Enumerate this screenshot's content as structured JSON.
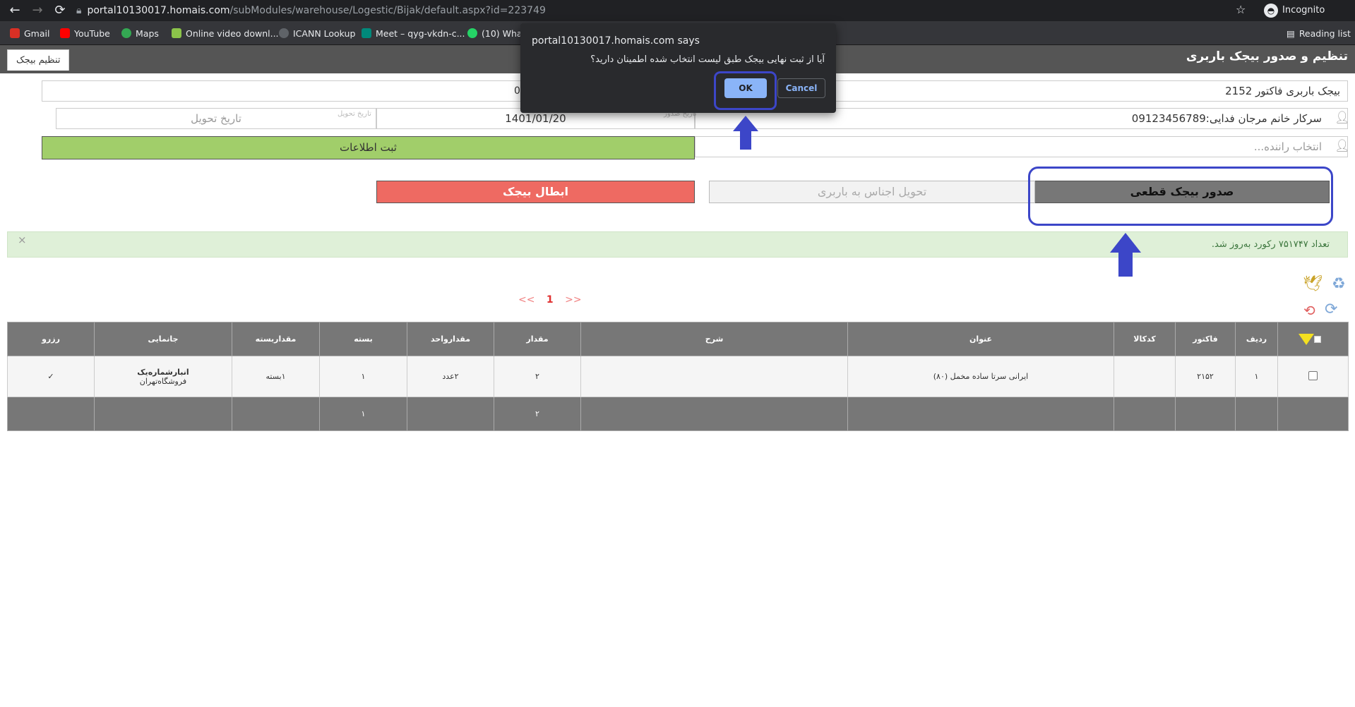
{
  "browser": {
    "url_host": "portal10130017.homais.com",
    "url_path": "/subModules/warehouse/Logestic/Bijak/default.aspx?id=223749",
    "profile_label": "Incognito",
    "reading_list_label": "Reading list",
    "bookmarks": [
      {
        "label": "Gmail",
        "color": "#d93025"
      },
      {
        "label": "YouTube",
        "color": "#ff0000"
      },
      {
        "label": "Maps",
        "color": "#34a853"
      },
      {
        "label": "Online video downl...",
        "color": "#8bc34a"
      },
      {
        "label": "ICANN Lookup",
        "color": "#5f6368"
      },
      {
        "label": "Meet – qyg-vkdn-c...",
        "color": "#00897b"
      },
      {
        "label": "(10) What",
        "color": "#25d366"
      }
    ]
  },
  "page": {
    "title": "تنظیم و صدور بیجک باربری",
    "tab_label": "تنظیم بیجک"
  },
  "form": {
    "bijak_title": "بیجک باربری فاکتور 2152",
    "left_value": "0",
    "customer": "سرکار خانم مرجان فدایی:09123456789",
    "date_value": "1401/01/20",
    "date_small_placeholder": "تاریخ صدور",
    "delivery_small_placeholder": "تاریخ تحویل",
    "delivery_placeholder": "تاریخ تحویل",
    "driver_placeholder": "انتخاب راننده...",
    "save_label": "ثبت اطلاعات",
    "issue_label": "صدور بیجک قطعی",
    "deliver_label": "تحویل اجناس به باربری",
    "void_label": "ابطال بیجک"
  },
  "alert": {
    "text": "تعداد ۷۵۱۷۴۷ رکورد به‌روز شد.",
    "close": "×"
  },
  "toolbar_icons": [
    "bird-export-icon",
    "recycle-icon",
    "refresh-icon",
    "undo-icon"
  ],
  "pager": {
    "prev": "<<",
    "current": "1",
    "next": ">>"
  },
  "table": {
    "headers": [
      "ردیف",
      "فاکتور",
      "کدکالا",
      "عنوان",
      "شرح",
      "مقدار",
      "مقدارواحد",
      "بسته",
      "مقداربسته",
      "جانمایی",
      "رزرو"
    ],
    "rows": [
      {
        "row": "۱",
        "invoice": "۲۱۵۲",
        "code": "",
        "title": "ایرانی سرتا ساده مخمل (۸۰)",
        "desc": "",
        "qty": "۲",
        "unit_qty": "۲عدد",
        "pack": "۱",
        "pack_qty": "۱بسته",
        "location_bold": "انبارشماره‌یک",
        "location": "فروشگاه‌تهران",
        "reserve": "✓"
      }
    ],
    "totals": {
      "qty": "۲",
      "pack": "۱"
    }
  },
  "dialog": {
    "title": "portal10130017.homais.com says",
    "message": "آیا از ثبت نهایی بیجک طبق لیست انتخاب شده اطمینان دارید؟",
    "ok": "OK",
    "cancel": "Cancel"
  },
  "colors": {
    "accent_highlight": "#3c46c8",
    "save_green": "#a1ce6a",
    "void_red": "#ee6a62",
    "alert_bg": "#dff0d8"
  }
}
